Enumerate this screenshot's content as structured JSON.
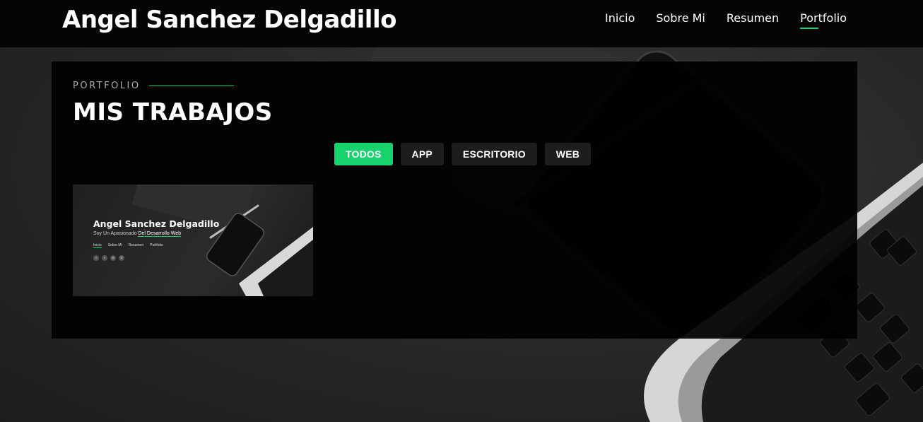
{
  "header": {
    "brand": "Angel Sanchez Delgadillo",
    "nav": [
      {
        "label": "Inicio",
        "active": false
      },
      {
        "label": "Sobre Mi",
        "active": false
      },
      {
        "label": "Resumen",
        "active": false
      },
      {
        "label": "Portfolio",
        "active": true
      }
    ]
  },
  "portfolio": {
    "label": "PORTFOLIO",
    "title": "MIS TRABAJOS",
    "filters": [
      {
        "label": "TODOS",
        "active": true
      },
      {
        "label": "APP",
        "active": false
      },
      {
        "label": "ESCRITORIO",
        "active": false
      },
      {
        "label": "WEB",
        "active": false
      }
    ],
    "items": [
      {
        "thumb_title": "Angel Sanchez Delgadillo",
        "thumb_subtitle_prefix": "Soy Un Apasionado ",
        "thumb_subtitle_highlight": "Del Desarrollo Web",
        "thumb_nav": [
          "Inicio",
          "Sobre Mi",
          "Resumen",
          "Portfolio"
        ],
        "thumb_social_icons": [
          "twitter-icon",
          "facebook-icon",
          "instagram-icon",
          "whatsapp-icon"
        ]
      }
    ]
  },
  "colors": {
    "accent": "#18d26e",
    "header_bg": "#050505",
    "panel_bg": "#000000",
    "filter_bg": "#1d1d1d"
  }
}
